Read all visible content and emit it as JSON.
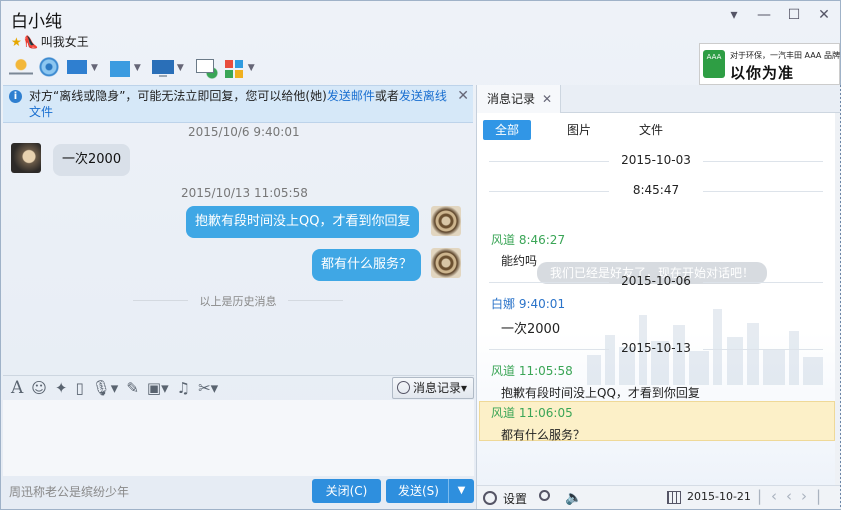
{
  "window": {
    "title": "白小纯",
    "status_text": "叫我女王"
  },
  "window_controls": [
    "▾",
    "—",
    "☐",
    "✕"
  ],
  "toolbar": {
    "icons": [
      "microphone-icon",
      "camera-icon",
      "screen-share-icon",
      "file-transfer-icon",
      "remote-assist-icon",
      "add-chat-icon",
      "apps-icon"
    ]
  },
  "ad": {
    "logo": "AAA",
    "line1": "对于环保，一汽丰田 AAA 品牌",
    "line2": "以你为准"
  },
  "notice": {
    "prefix": "对方“离线或隐身”，可能无法立即回复，您可以给他(她)",
    "link1": "发送邮件",
    "mid": "或者",
    "link2": "发送离线文件"
  },
  "chat": {
    "ts1": "2015/10/6 9:40:01",
    "msg1": "一次2000",
    "ts2": "2015/10/13 11:05:58",
    "msg2": "抱歉有段时间没上QQ，才看到你回复",
    "msg3": "都有什么服务？",
    "history": "以上是历史消息"
  },
  "editor": {
    "record_button": "消息记录",
    "input_hint": "周迅称老公是缤纷少年"
  },
  "actions": {
    "close": "关闭(C)",
    "send": "发送(S)"
  },
  "history_panel": {
    "tab": "消息记录",
    "filters": [
      "全部",
      "图片",
      "文件"
    ],
    "d1": "2015-10-03",
    "time1": "8:45:47",
    "system": "我们已经是好友了，现在开始对话吧！",
    "s1": "风道 8:46:27",
    "m1": "能约吗",
    "d2": "2015-10-06",
    "s2": "白娜 9:40:01",
    "m2": "一次2000",
    "d3": "2015-10-13",
    "s3": "风道 11:05:58",
    "m3": "抱歉有段时间没上QQ，才看到你回复",
    "s4": "风道 11:06:05",
    "m4": "都有什么服务？",
    "settings": "设置",
    "date": "2015-10-21"
  },
  "colors": {
    "accent": "#2e8fde",
    "bubble_out": "#3fa7e5",
    "sender_green": "#3aa556",
    "sender_blue": "#2a73c9",
    "highlight": "#fcf0c8"
  }
}
